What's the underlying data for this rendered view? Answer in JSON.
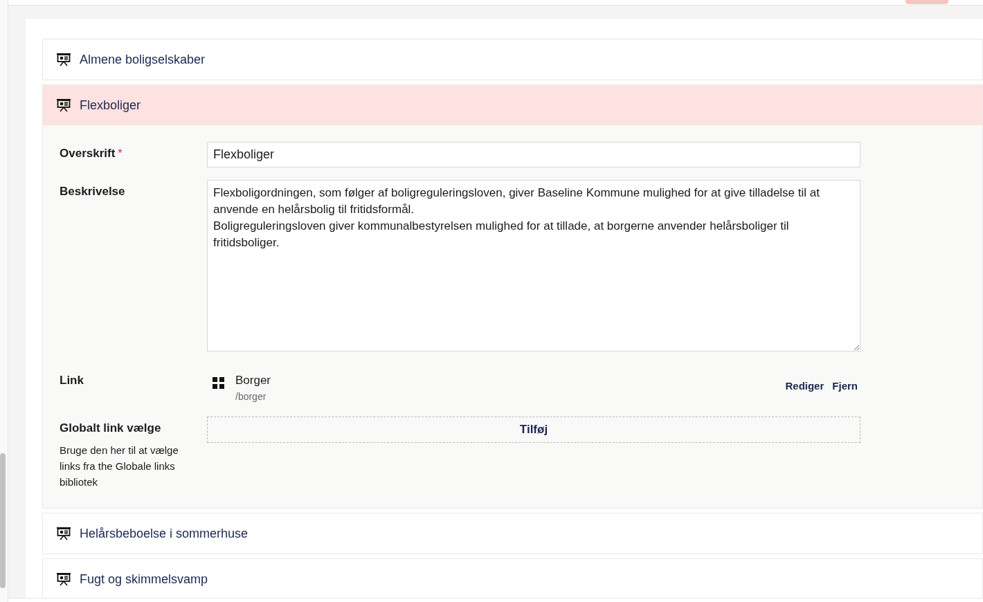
{
  "items": [
    {
      "title": "Almene boligselskaber",
      "expanded": false
    },
    {
      "title": "Flexboliger",
      "expanded": true,
      "fields": [
        {
          "kind": "text",
          "label": "Overskrift",
          "required_mark": "*",
          "value": "Flexboliger"
        },
        {
          "kind": "textarea",
          "label": "Beskrivelse",
          "value": "Flexboligordningen, som følger af boligreguleringsloven, giver Baseline Kommune mulighed for at give tilladelse til at anvende en helårsbolig til fritidsformål.\nBoligreguleringsloven giver kommunalbestyrelsen mulighed for at tillade, at borgerne anvender helårsboliger til fritidsboliger."
        },
        {
          "kind": "link",
          "label": "Link",
          "name": "Borger",
          "path": "/borger",
          "actions": [
            "Rediger",
            "Fjern"
          ]
        },
        {
          "kind": "picker",
          "label": "Globalt link vælge",
          "description": "Bruge den her til at vælge links fra the Globale links bibliotek",
          "button": "Tilføj"
        }
      ]
    },
    {
      "title": "Helårsbeboelse i sommerhuse",
      "expanded": false
    },
    {
      "title": "Fugt og skimmelsvamp",
      "expanded": false
    }
  ]
}
